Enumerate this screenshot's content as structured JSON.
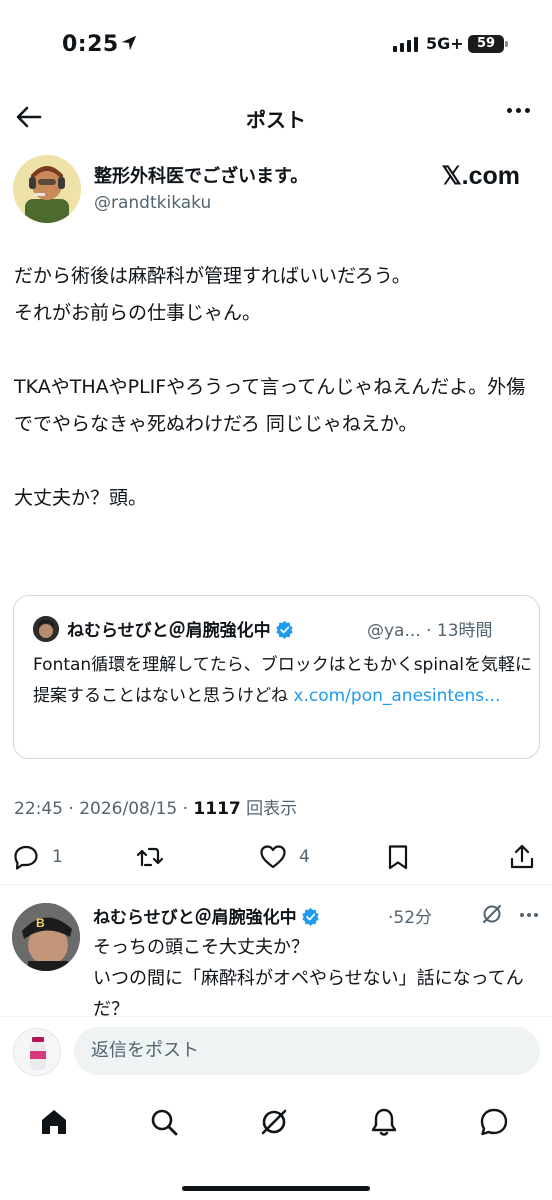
{
  "status_bar": {
    "time": "0:25",
    "network": "5G+",
    "battery": "59"
  },
  "header": {
    "title": "ポスト"
  },
  "author": {
    "name": "整形外科医でございます。",
    "handle": "@randtkikaku",
    "brand": "𝕏.com"
  },
  "tweet": {
    "text": "だから術後は麻酔科が管理すればいいだろう。\nそれがお前らの仕事じゃん。\n\nTKAやTHAやPLIFやろうって言ってんじゃねえんだよ。外傷ででやらなきゃ死ぬわけだろ 同じじゃねえか。\n\n大丈夫か？頭。"
  },
  "quote": {
    "name": "ねむらせびと＠肩腕強化中",
    "handle": "@ya...",
    "time": "13時間",
    "text": "Fontan循環を理解してたら、ブロックはともかくspinalを気軽に提案することはないと思うけどね ",
    "link": "x.com/pon_anesintens..."
  },
  "meta": {
    "time": "22:45",
    "date": "2026/08/15",
    "views_count": "1117",
    "views_label": "回表示"
  },
  "actions": {
    "replies": "1",
    "likes": "4"
  },
  "reply": {
    "name": "ねむらせびと＠肩腕強化中",
    "time": "52分",
    "text": "そっちの頭こそ大丈夫か？\nいつの間に「麻酔科がオペやらせない」話になってんだ？"
  },
  "compose": {
    "placeholder": "返信をポスト"
  },
  "colors": {
    "accent": "#1d9bf0",
    "text": "#0f1419",
    "secondary": "#536471",
    "border": "#cfd9de"
  },
  "icons": [
    "back-arrow-icon",
    "more-icon",
    "verified-icon",
    "reply-icon",
    "repost-icon",
    "like-icon",
    "bookmark-icon",
    "share-icon",
    "grok-icon",
    "home-icon",
    "search-icon",
    "notifications-icon",
    "messages-icon"
  ]
}
